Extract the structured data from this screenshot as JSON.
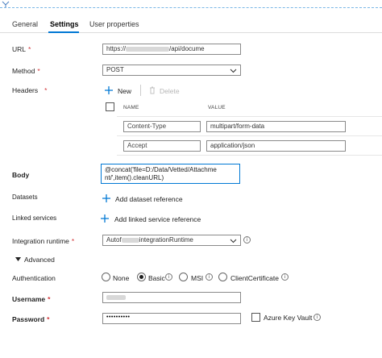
{
  "tabs": [
    {
      "label": "General"
    },
    {
      "label": "Settings"
    },
    {
      "label": "User properties"
    }
  ],
  "url": {
    "label": "URL",
    "value_prefix": "https://",
    "value_suffix": "/api/docume"
  },
  "method": {
    "label": "Method",
    "value": "POST"
  },
  "headers": {
    "label": "Headers",
    "new_label": "New",
    "delete_label": "Delete",
    "col_name": "NAME",
    "col_value": "VALUE",
    "rows": [
      {
        "name": "Content-Type",
        "value": "multipart/form-data"
      },
      {
        "name": "Accept",
        "value": "application/json"
      }
    ]
  },
  "body": {
    "label": "Body",
    "value_line1": "@concat('file=D:/Data/Vetted/Attachme",
    "value_line2": "nt/',item().cleanURL)"
  },
  "datasets": {
    "label": "Datasets",
    "add_label": "Add dataset reference"
  },
  "linked_services": {
    "label": "Linked services",
    "add_label": "Add linked service reference"
  },
  "integration_runtime": {
    "label": "Integration runtime",
    "value_prefix": "Autof",
    "value_suffix": "integrationRuntime"
  },
  "advanced": {
    "label": "Advanced"
  },
  "authentication": {
    "label": "Authentication",
    "options": [
      {
        "label": "None",
        "selected": false
      },
      {
        "label": "Basic",
        "selected": true
      },
      {
        "label": "MSI",
        "selected": false
      },
      {
        "label": "ClientCertificate",
        "selected": false
      }
    ]
  },
  "username": {
    "label": "Username"
  },
  "password": {
    "label": "Password",
    "value": "••••••••••",
    "key_vault_label": "Azure Key Vault"
  },
  "colors": {
    "accent": "#0078d4",
    "required": "#d13438"
  }
}
